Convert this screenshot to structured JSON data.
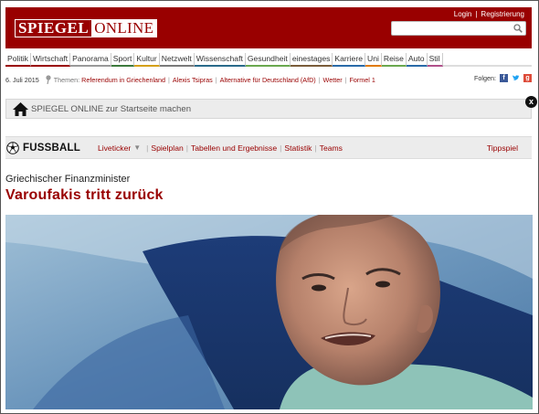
{
  "header": {
    "logo_part1": "SPIEGEL",
    "logo_part2": "ONLINE",
    "login": "Login",
    "divider": "|",
    "register": "Registrierung",
    "search_placeholder": ""
  },
  "nav": {
    "items": [
      {
        "label": "Politik",
        "color": "#990000"
      },
      {
        "label": "Wirtschaft",
        "color": "#990000"
      },
      {
        "label": "Panorama",
        "color": "#999999"
      },
      {
        "label": "Sport",
        "color": "#3d7a3d"
      },
      {
        "label": "Kultur",
        "color": "#d4a017"
      },
      {
        "label": "Netzwelt",
        "color": "#7a7a7a"
      },
      {
        "label": "Wissenschaft",
        "color": "#2a6a8a"
      },
      {
        "label": "Gesundheit",
        "color": "#6aa84f"
      },
      {
        "label": "einestages",
        "color": "#7a5c3a"
      },
      {
        "label": "Karriere",
        "color": "#2a6aa8"
      },
      {
        "label": "Uni",
        "color": "#e07a00"
      },
      {
        "label": "Reise",
        "color": "#6aa84f"
      },
      {
        "label": "Auto",
        "color": "#2a6aa8"
      },
      {
        "label": "Stil",
        "color": "#b0508a"
      }
    ]
  },
  "themes": {
    "date": "6. Juli 2015",
    "label": "Themen:",
    "links": [
      "Referendum in Griechenland",
      "Alexis Tsipras",
      "Alternative für Deutschland (AfD)",
      "Wetter",
      "Formel 1"
    ],
    "follow_label": "Folgen:",
    "social_icons": [
      "facebook-icon",
      "twitter-icon",
      "googleplus-icon"
    ]
  },
  "startbar": {
    "text": "SPIEGEL ONLINE zur Startseite machen",
    "close": "x"
  },
  "fussball": {
    "title": "FUSSBALL",
    "links": [
      "Liveticker",
      "Spielplan",
      "Tabellen und Ergebnisse",
      "Statistik",
      "Teams"
    ],
    "caret": "▼",
    "tippspiel": "Tippspiel"
  },
  "article": {
    "kicker": "Griechischer Finanzminister",
    "headline": "Varoufakis tritt zurück"
  },
  "colors": {
    "brand": "#990000",
    "bar_bg": "#ececec"
  }
}
